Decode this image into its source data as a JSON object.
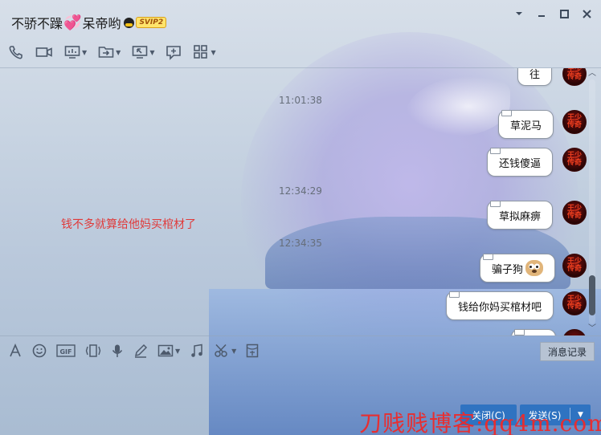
{
  "window": {
    "title": "不骄不躁",
    "title_suffix": "呆帝哟",
    "vip_badge": "SVIP2",
    "controls": [
      "chevron-down-icon",
      "minimize-icon",
      "maximize-icon",
      "close-icon"
    ]
  },
  "toolbar": {
    "items": [
      "phone-icon",
      "video-icon",
      "screen-share-icon",
      "file-transfer-icon",
      "remote-desktop-icon",
      "whiteboard-icon",
      "apps-icon"
    ]
  },
  "chat": {
    "timestamps": [
      "11:01:38",
      "12:34:29",
      "12:34:35"
    ],
    "incoming_message": "钱不多就算给他妈买棺材了",
    "messages": [
      {
        "text": "往",
        "emoji": ""
      },
      {
        "text": "草泥马",
        "emoji": ""
      },
      {
        "text": "还钱傻逼",
        "emoji": ""
      },
      {
        "text": "草拟麻痹",
        "emoji": ""
      },
      {
        "text": "骗子狗",
        "emoji": "dog-emoji-icon"
      },
      {
        "text": "钱给你妈买棺材吧",
        "emoji": ""
      }
    ],
    "avatar_text": "王少传奇"
  },
  "input_toolbar": {
    "items": [
      "font-icon",
      "emoji-icon",
      "gif-icon",
      "shake-icon",
      "voice-icon",
      "doodle-icon",
      "image-icon",
      "music-icon",
      "screenshot-icon",
      "red-packet-icon"
    ],
    "history_label": "消息记录"
  },
  "actions": {
    "close_label": "关闭(C)",
    "send_label": "发送(S)"
  },
  "watermark": "刀贱贱博客:qq4m.com"
}
